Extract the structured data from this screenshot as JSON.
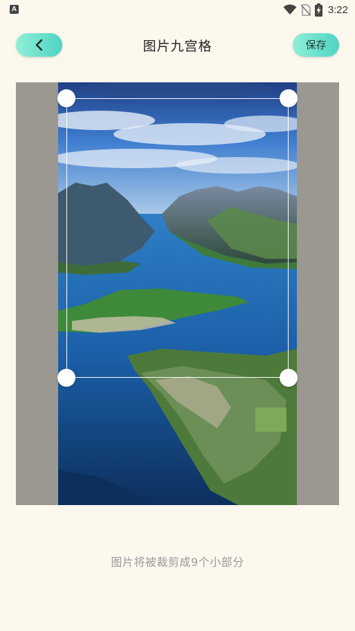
{
  "status_bar": {
    "left_icon": "A",
    "time": "3:22",
    "icons": [
      "wifi-icon",
      "no-sim-icon",
      "battery-charging-icon"
    ]
  },
  "header": {
    "back_icon": "chevron-left-icon",
    "title": "图片九宫格",
    "save_label": "保存"
  },
  "editor": {
    "image": "mountain-fjord-landscape-photo",
    "crop_handles": [
      "top-left",
      "top-right",
      "bottom-left",
      "bottom-right"
    ]
  },
  "hint": "图片将被裁剪成9个小部分",
  "colors": {
    "accent_start": "#8ef0d6",
    "accent_end": "#4fd3c4",
    "background": "#fdf8ee",
    "editor_backdrop": "#9a9890"
  }
}
